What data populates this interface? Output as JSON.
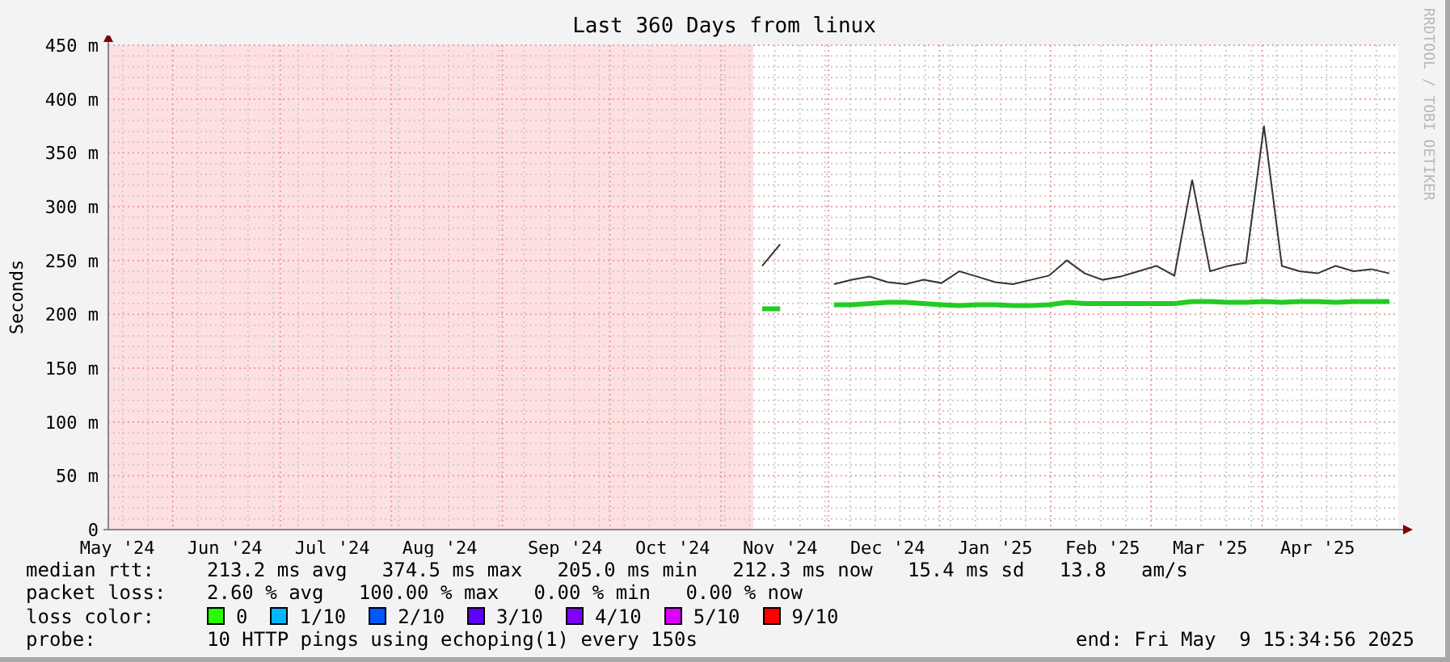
{
  "title": "Last 360 Days from linux",
  "credit": "RRDTOOL / TOBI OETIKER",
  "chart": {
    "chart_data": {
      "type": "line",
      "grid": true,
      "ylabel": "Seconds",
      "ylim": [
        0,
        450
      ],
      "categories": [
        "May '24",
        null,
        null,
        null,
        null,
        null,
        "Jun '24",
        null,
        null,
        null,
        null,
        null,
        "Jul '24",
        null,
        null,
        null,
        null,
        null,
        "Aug '24",
        null,
        null,
        null,
        null,
        null,
        null,
        "Sep '24",
        null,
        null,
        null,
        null,
        null,
        "Oct '24",
        null,
        null,
        null,
        null,
        null,
        "Nov '24",
        null,
        null,
        null,
        null,
        null,
        "Dec '24",
        null,
        null,
        null,
        null,
        null,
        "Jan '25",
        null,
        null,
        null,
        null,
        null,
        "Feb '25",
        null,
        null,
        null,
        null,
        null,
        "Mar '25",
        null,
        null,
        null,
        null,
        null,
        "Apr '25",
        null,
        null,
        null,
        null
      ],
      "series": [
        {
          "color": "#333333",
          "values": [
            null,
            null,
            null,
            null,
            null,
            null,
            null,
            null,
            null,
            null,
            null,
            null,
            null,
            null,
            null,
            null,
            null,
            null,
            null,
            null,
            null,
            null,
            null,
            null,
            null,
            null,
            null,
            null,
            null,
            null,
            null,
            null,
            null,
            null,
            null,
            null,
            245,
            265,
            null,
            null,
            228,
            232,
            235,
            230,
            228,
            232,
            229,
            240,
            235,
            230,
            228,
            232,
            236,
            250,
            238,
            232,
            235,
            240,
            245,
            236,
            325,
            240,
            245,
            248,
            375,
            245,
            240,
            238,
            245,
            240,
            242,
            238
          ]
        },
        {
          "color": "#22cc22",
          "values": [
            null,
            null,
            null,
            null,
            null,
            null,
            null,
            null,
            null,
            null,
            null,
            null,
            null,
            null,
            null,
            null,
            null,
            null,
            null,
            null,
            null,
            null,
            null,
            null,
            null,
            null,
            null,
            null,
            null,
            null,
            null,
            null,
            null,
            null,
            null,
            null,
            205,
            205,
            null,
            null,
            209,
            209,
            210,
            211,
            211,
            210,
            209,
            208,
            209,
            209,
            208,
            208,
            209,
            211,
            210,
            210,
            210,
            210,
            210,
            210,
            212,
            212,
            211,
            211,
            212,
            211,
            212,
            212,
            211,
            212,
            212,
            212
          ]
        }
      ],
      "yticks": [
        {
          "value": 0,
          "label": "0"
        },
        {
          "value": 50,
          "label": "50 m"
        },
        {
          "value": 100,
          "label": "100 m"
        },
        {
          "value": 150,
          "label": "150 m"
        },
        {
          "value": 200,
          "label": "200 m"
        },
        {
          "value": 250,
          "label": "250 m"
        },
        {
          "value": 300,
          "label": "300 m"
        },
        {
          "value": 350,
          "label": "350 m"
        },
        {
          "value": 400,
          "label": "400 m"
        },
        {
          "value": 450,
          "label": "450 m"
        }
      ]
    }
  },
  "legend": {
    "median_rtt": {
      "label": "median rtt:",
      "value": "213.2 ms avg   374.5 ms max   205.0 ms min   212.3 ms now   15.4 ms sd   13.8   am/s"
    },
    "packet_loss": {
      "label": "packet loss:",
      "value": "2.60 % avg   100.00 % max   0.00 % min   0.00 % now"
    },
    "loss_color": {
      "label": "loss color:",
      "items": [
        {
          "label": "0",
          "color": "#26ff00"
        },
        {
          "label": "1/10",
          "color": "#00b8ff"
        },
        {
          "label": "2/10",
          "color": "#0059ff"
        },
        {
          "label": "3/10",
          "color": "#5e00ff"
        },
        {
          "label": "4/10",
          "color": "#7e00ff"
        },
        {
          "label": "5/10",
          "color": "#dd00ff"
        },
        {
          "label": "9/10",
          "color": "#ff0000"
        }
      ]
    },
    "probe": {
      "label": "probe:",
      "value": "10 HTTP pings using echoping(1) every 150s"
    },
    "end": "end: Fri May  9 15:34:56 2025"
  }
}
